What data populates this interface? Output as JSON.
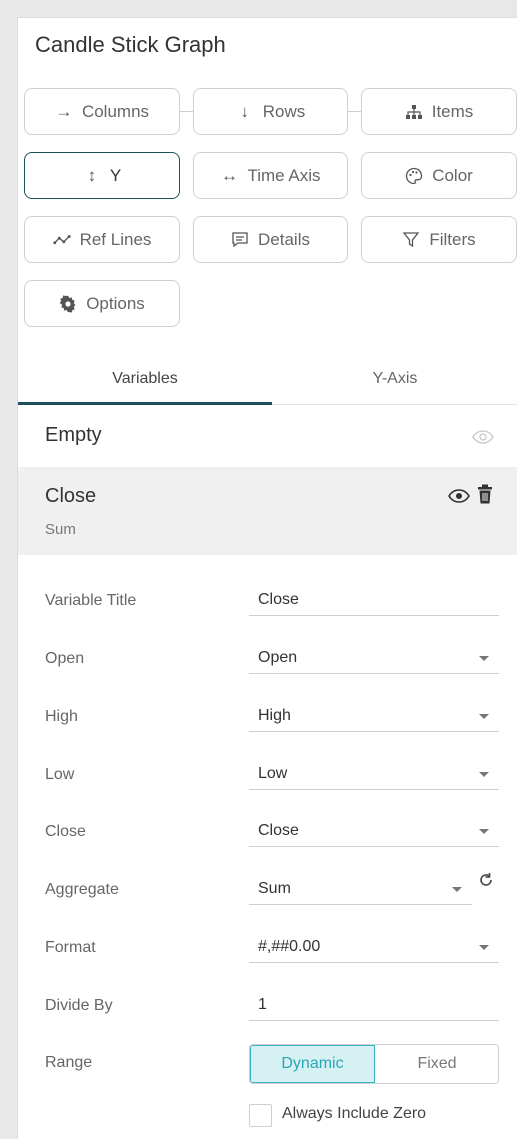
{
  "panel": {
    "title": "Candle Stick Graph"
  },
  "buttons": {
    "columns": "Columns",
    "rows": "Rows",
    "items": "Items",
    "y": "Y",
    "time_axis": "Time Axis",
    "color": "Color",
    "ref_lines": "Ref Lines",
    "details": "Details",
    "filters": "Filters",
    "options": "Options"
  },
  "tabs": {
    "variables": "Variables",
    "y_axis": "Y-Axis",
    "active": "Variables"
  },
  "variables": [
    {
      "name": "Empty"
    },
    {
      "name": "Close",
      "aggregate": "Sum"
    }
  ],
  "form": {
    "variable_title": {
      "label": "Variable Title",
      "value": "Close"
    },
    "open": {
      "label": "Open",
      "value": "Open"
    },
    "high": {
      "label": "High",
      "value": "High"
    },
    "low": {
      "label": "Low",
      "value": "Low"
    },
    "close": {
      "label": "Close",
      "value": "Close"
    },
    "aggregate": {
      "label": "Aggregate",
      "value": "Sum"
    },
    "format": {
      "label": "Format",
      "value": "#,##0.00"
    },
    "divide_by": {
      "label": "Divide By",
      "value": "1"
    },
    "range": {
      "label": "Range",
      "options": [
        "Dynamic",
        "Fixed"
      ],
      "selected": "Dynamic"
    },
    "always_include_zero": {
      "label": "Always Include Zero",
      "checked": false
    }
  },
  "colors": {
    "accent": "#1e4f5c",
    "selected_fill": "#d6f1f4",
    "selected_text": "#2aa6b6"
  }
}
